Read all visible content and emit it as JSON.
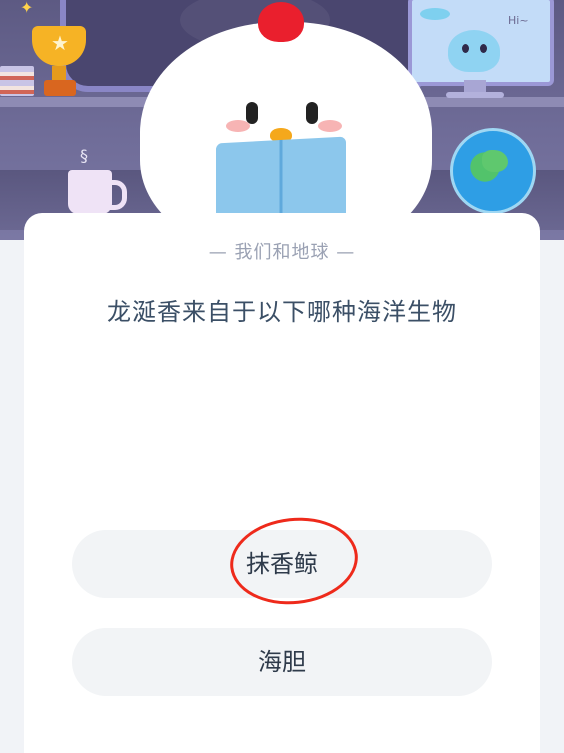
{
  "quiz": {
    "category": "— 我们和地球 —",
    "question": "龙涎香来自于以下哪种海洋生物",
    "options": [
      {
        "label": "抹香鲸"
      },
      {
        "label": "海胆"
      }
    ]
  },
  "scene": {
    "speech_bubble": "Hi~",
    "icons": [
      "trophy-icon",
      "sparkle-icon",
      "books-icon",
      "monitor-icon",
      "alien-icon",
      "ufo-icon",
      "mug-icon",
      "globe-icon",
      "chicken-mascot"
    ]
  },
  "colors": {
    "card_background": "#ffffff",
    "option_background": "#f2f4f6",
    "question_text": "#3b4f66",
    "category_text": "#9aa1b3",
    "annotation_circle": "#ee2a1b"
  }
}
